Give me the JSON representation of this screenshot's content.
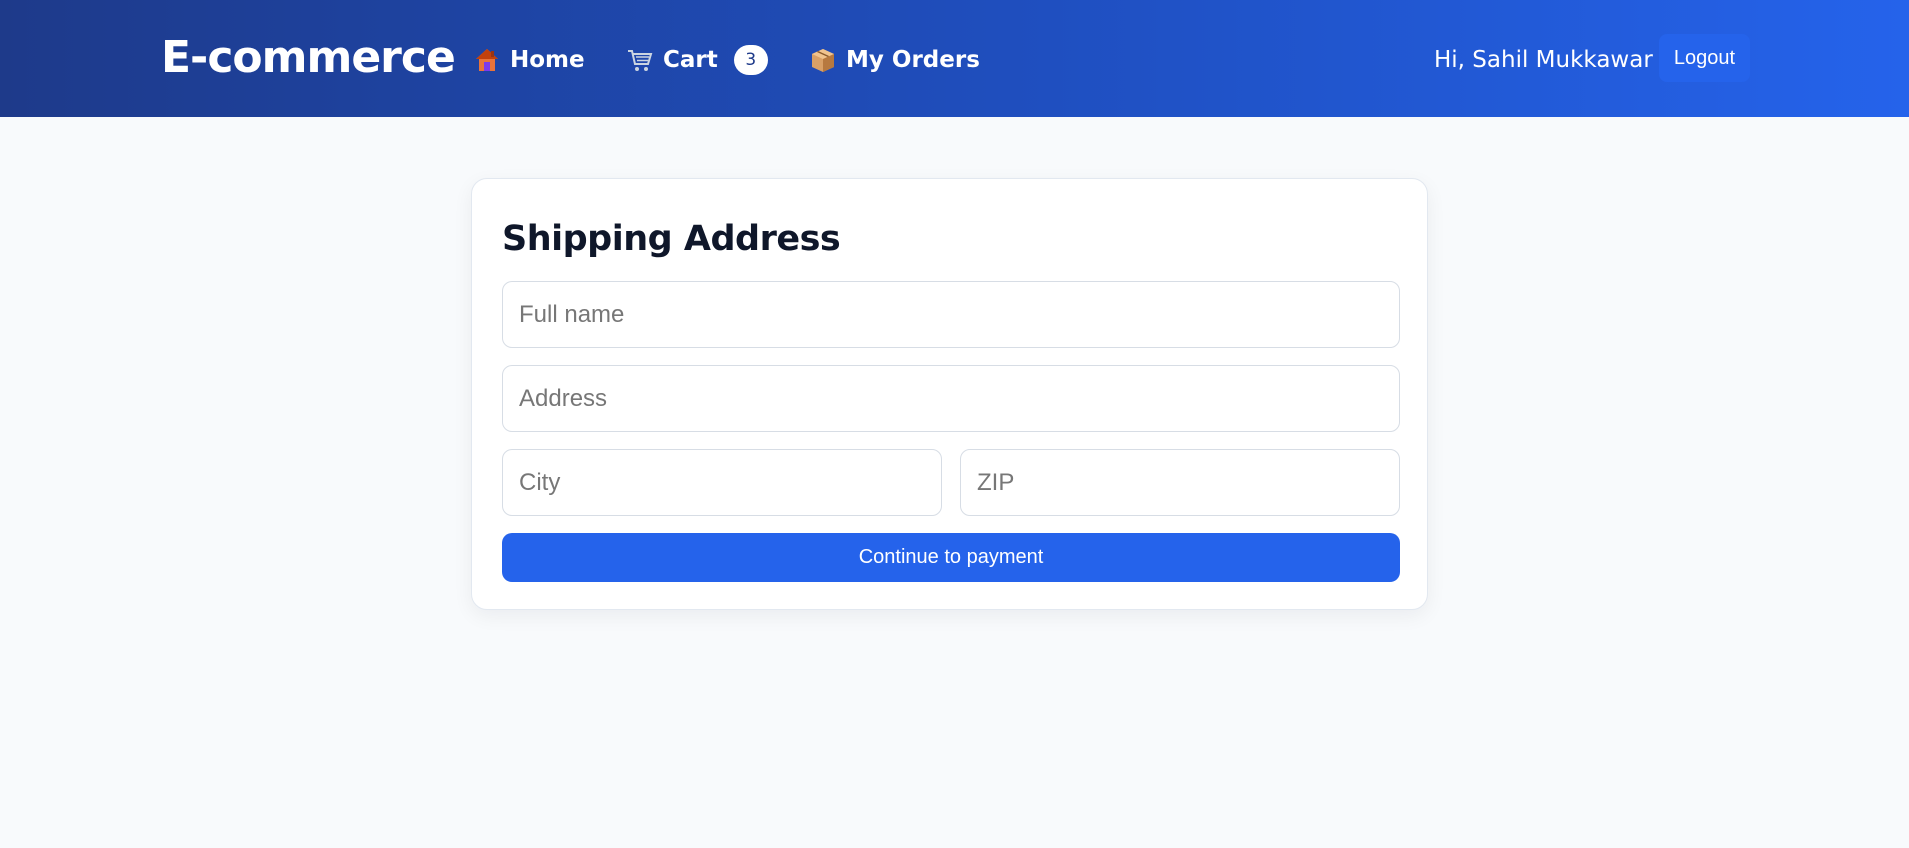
{
  "header": {
    "brand": "E-commerce",
    "nav": {
      "home": {
        "label": "Home",
        "icon": "house-icon"
      },
      "cart": {
        "label": "Cart",
        "icon": "shopping-cart-icon",
        "count": "3"
      },
      "orders": {
        "label": "My Orders",
        "icon": "package-icon"
      }
    },
    "greeting": "Hi, Sahil Mukkawar",
    "logout_label": "Logout"
  },
  "form": {
    "title": "Shipping Address",
    "full_name": {
      "value": "",
      "placeholder": "Full name"
    },
    "address": {
      "value": "",
      "placeholder": "Address"
    },
    "city": {
      "value": "",
      "placeholder": "City"
    },
    "zip": {
      "value": "",
      "placeholder": "ZIP"
    },
    "submit_label": "Continue to payment"
  },
  "colors": {
    "header_start": "#1e3a8a",
    "header_end": "#2563eb",
    "primary": "#2563eb",
    "background": "#f8fafc",
    "title_text": "#0f172a"
  }
}
